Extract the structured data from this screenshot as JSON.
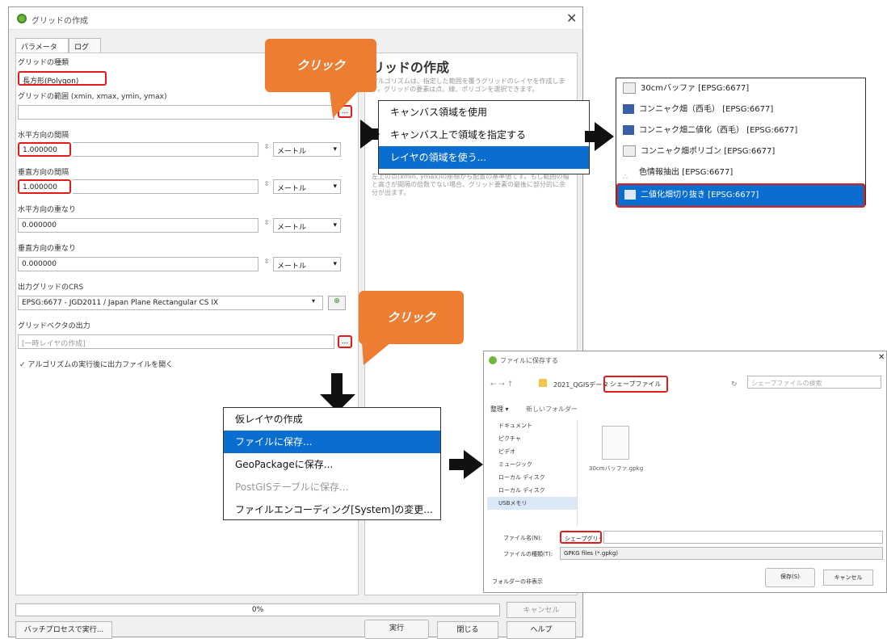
{
  "dialog": {
    "title": "グリッドの作成",
    "tabs": [
      "パラメーター",
      "ログ"
    ],
    "grid_type_label": "グリッドの種類",
    "grid_type_value": "長方形(Polygon)",
    "extent_label": "グリッドの範囲 (xmin, xmax, ymin, ymax)",
    "extent_value": "",
    "h_spacing_label": "水平方向の間隔",
    "h_spacing_value": "1.000000",
    "v_spacing_label": "垂直方向の間隔",
    "v_spacing_value": "1.000000",
    "h_overlay_label": "水平方向の重なり",
    "h_overlay_value": "0.000000",
    "v_overlay_label": "垂直方向の重なり",
    "v_overlay_value": "0.000000",
    "unit_value": "メートル",
    "crs_label": "出力グリッドのCRS",
    "crs_value": "EPSG:6677 - JGD2011 / Japan Plane Rectangular CS IX",
    "output_label": "グリッドベクタの出力",
    "output_placeholder": "[一時レイヤの作成]",
    "open_after_label": "アルゴリズムの実行後に出力ファイルを開く",
    "progress_text": "0%",
    "cancel_label": "キャンセル",
    "batch_label": "バッチプロセスで実行...",
    "run_label": "実行",
    "close_label": "閉じる",
    "help_label": "ヘルプ",
    "ellipsis": "..."
  },
  "help": {
    "title": "リッドの作成",
    "para1": "アルゴリズムは、指定した範囲を覆うグリッドのレイヤを作成します。グリッドの要素は点、線、ポリゴンを選択できます。",
    "para2": "左上の点(xmin, ymax)の座標から配置の基準値です。もし範囲の幅と高さが間隔の倍数でない場合、グリッド要素の最後に部分的に余分が出ます。"
  },
  "callouts": [
    "クリック",
    "クリック"
  ],
  "extent_menu": {
    "items": [
      "キャンバス領域を使用",
      "キャンバス上で領域を指定する",
      "レイヤの領域を使う..."
    ],
    "selected": 2
  },
  "layer_list": {
    "items": [
      {
        "name": "30cmバッファ [EPSG:6677]",
        "icon": "polygon-layer-icon"
      },
      {
        "name": "コンニャク畑（西毛） [EPSG:6677]",
        "icon": "raster-layer-icon"
      },
      {
        "name": "コンニャク畑二値化（西毛） [EPSG:6677]",
        "icon": "raster-layer-icon"
      },
      {
        "name": "コンニャク畑ポリゴン [EPSG:6677]",
        "icon": "polygon-layer-icon"
      },
      {
        "name": "色情報抽出 [EPSG:6677]",
        "icon": "point-layer-icon"
      },
      {
        "name": "二値化畑切り抜き [EPSG:6677]",
        "icon": "raster-layer-icon"
      }
    ],
    "selected": 5
  },
  "output_menu": {
    "items": [
      "仮レイヤの作成",
      "ファイルに保存...",
      "GeoPackageに保存...",
      "PostGISテーブルに保存...",
      "ファイルエンコーディング[System]の変更..."
    ],
    "selected": 1,
    "disabled": [
      3
    ]
  },
  "save_dialog": {
    "title": "ファイルに保存する",
    "breadcrumb": "2021_QGISデータ",
    "folder": "シェープファイル",
    "search_placeholder": "シェープファイルの検索",
    "organize": "整理 ▾",
    "new_folder": "新しいフォルダー",
    "sidebar": [
      "ドキュメント",
      "ピクチャ",
      "ビデオ",
      "ミュージック",
      "ローカル ディスク",
      "ローカル ディスク",
      "USBメモリ"
    ],
    "file_name": "30cmバッファ.gpkg",
    "filename_label": "ファイル名(N):",
    "filename_value": "シェープグリッド",
    "filetype_label": "ファイルの種類(T):",
    "filetype_value": "GPKG files (*.gpkg)",
    "hide_folders": "フォルダーの非表示",
    "save_label": "保存(S)",
    "cancel_label": "キャンセル"
  },
  "colors": {
    "accent_orange": "#ec7d31",
    "highlight_red": "#e21b1b",
    "selection_blue": "#0a6ed1"
  }
}
